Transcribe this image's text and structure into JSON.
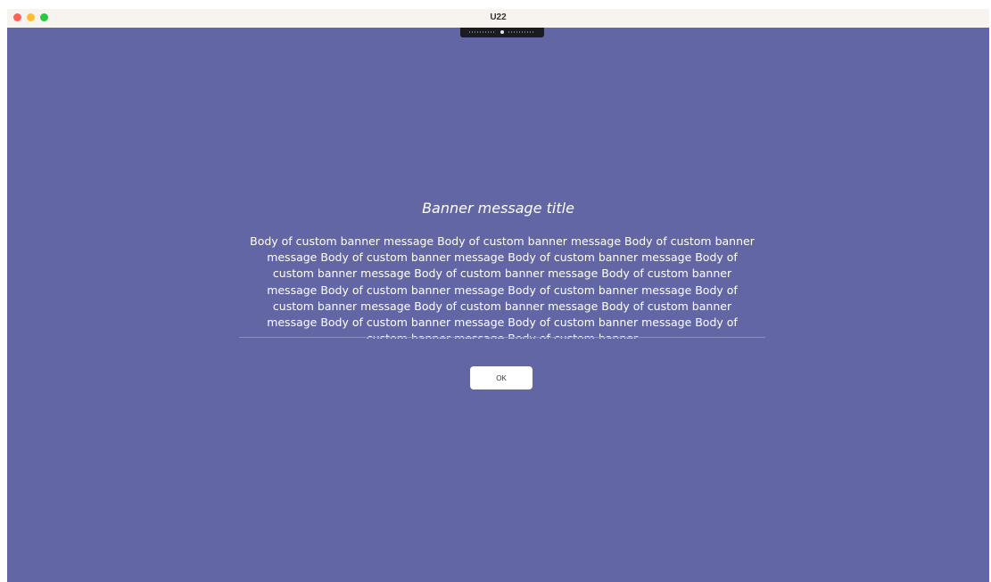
{
  "window": {
    "title": "U22"
  },
  "banner": {
    "title": "Banner message title",
    "body": "Body of custom banner message Body of custom banner message Body of custom banner message Body of custom banner message Body of custom banner message Body of custom banner message Body of custom banner message Body of custom banner message Body of custom banner message Body of custom banner message Body of custom banner message Body of custom banner message Body of custom banner message Body of custom banner message Body of custom banner message Body of custom banner message Body of custom banner",
    "ok_label": "OK"
  },
  "colors": {
    "background": "#6366a5",
    "titlebar": "#f7f3ee",
    "close": "#fe5f57",
    "minimize": "#febc2e",
    "maximize": "#28c840"
  },
  "icons": [
    "close-icon",
    "minimize-icon",
    "maximize-icon",
    "camera-notch-icon"
  ]
}
